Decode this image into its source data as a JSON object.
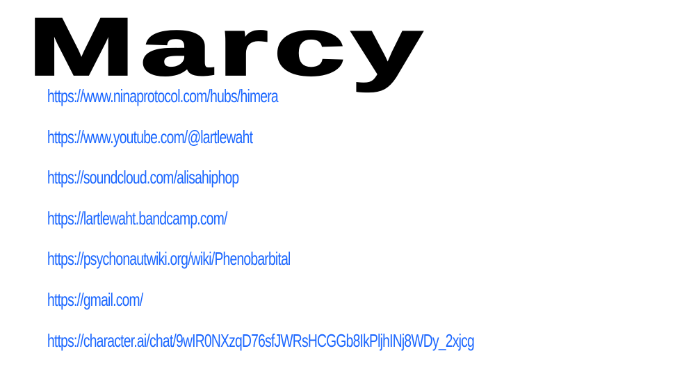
{
  "header": {
    "title": "Marcy"
  },
  "colors": {
    "link": "#1a66ff",
    "title": "#000000",
    "background": "#ffffff"
  },
  "links": [
    {
      "label": "https://www.ninaprotocol.com/hubs/himera"
    },
    {
      "label": "https://www.youtube.com/@lartlewaht"
    },
    {
      "label": "https://soundcloud.com/alisahiphop"
    },
    {
      "label": "https://lartlewaht.bandcamp.com/"
    },
    {
      "label": "https://psychonautwiki.org/wiki/Phenobarbital"
    },
    {
      "label": "https://gmail.com/"
    },
    {
      "label": "https://character.ai/chat/9wIR0NXzqD76sfJWRsHCGGb8IkPljhINj8WDy_2xjcg"
    }
  ]
}
